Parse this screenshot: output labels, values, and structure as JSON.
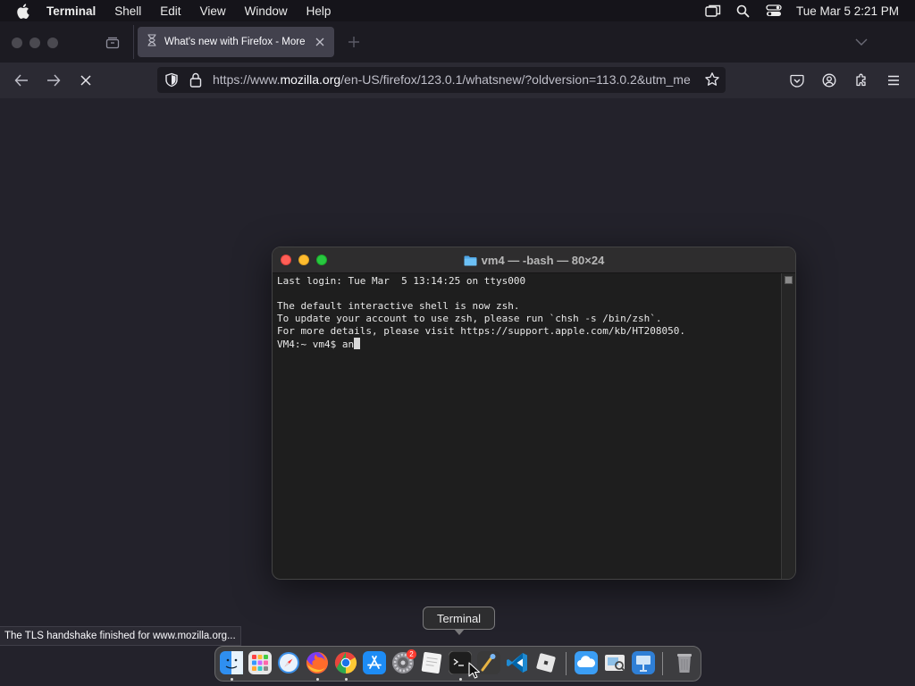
{
  "menubar": {
    "app_name": "Terminal",
    "items": [
      "Shell",
      "Edit",
      "View",
      "Window",
      "Help"
    ],
    "clock": "Tue Mar 5  2:21 PM",
    "icons": [
      "apple-icon",
      "screen-mirroring-icon",
      "spotlight-search-icon",
      "control-center-icon"
    ]
  },
  "browser": {
    "tab_title": "What's new with Firefox - More",
    "url_prefix": "https://www.",
    "url_host": "mozilla.org",
    "url_path": "/en-US/firefox/123.0.1/whatsnew/?oldversion=113.0.2&utm_me",
    "status_text": "The TLS handshake finished for www.mozilla.org..."
  },
  "terminal": {
    "title": "vm4 — -bash — 80×24",
    "lines": [
      "Last login: Tue Mar  5 13:14:25 on ttys000",
      "",
      "The default interactive shell is now zsh.",
      "To update your account to use zsh, please run `chsh -s /bin/zsh`.",
      "For more details, please visit https://support.apple.com/kb/HT208050."
    ],
    "prompt": "VM4:~ vm4$ ",
    "typed": "an"
  },
  "dock": {
    "tooltip": "Terminal",
    "settings_badge": "2",
    "colors": {
      "finder": "#2f8ff0",
      "launchpad": "#e8e8e8",
      "safari": "#3a8ee6",
      "firefox": "#ff6b2b",
      "chrome": "#e8453c",
      "app_store": "#1d8cf5",
      "settings": "#8e8e93",
      "textedit": "#f2f2f2",
      "terminal": "#1e1e1e",
      "instruments": "#3a3a3a",
      "vscode": "#1f8ad2",
      "roblox": "#e6e6e6",
      "icloud": "#3b9ef5",
      "preview": "#e9e9e9",
      "keynote": "#2f7fd6",
      "trash": "#9a9a9e"
    }
  }
}
